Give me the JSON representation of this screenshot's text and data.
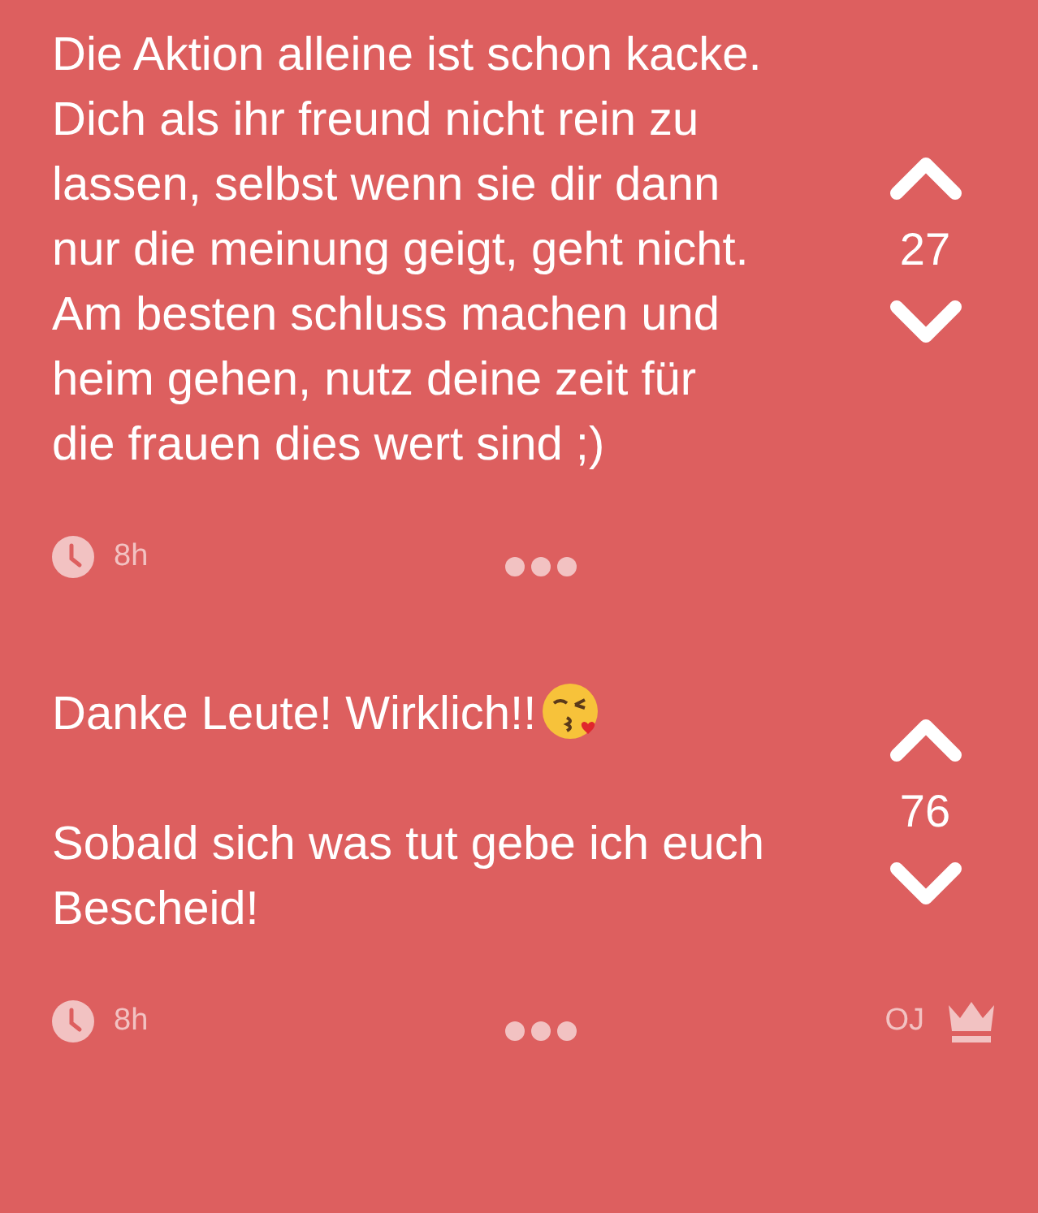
{
  "posts": [
    {
      "paragraphs": [
        {
          "text": "Die Aktion alleine ist schon kacke. Dich als ihr freund nicht rein zu lassen, selbst wenn sie dir dann nur die meinung geigt, geht nicht. Am besten schluss machen und heim gehen, nutz deine zeit für die frauen dies wert sind ;)",
          "emoji": false
        }
      ],
      "votes": "27",
      "time": "8h"
    },
    {
      "paragraphs": [
        {
          "text": "Danke Leute! Wirklich!!",
          "emoji": true
        },
        {
          "text": "Sobald sich was tut gebe ich euch Bescheid!",
          "emoji": false
        }
      ],
      "votes": "76",
      "time": "8h",
      "author_badge": "OJ"
    }
  ]
}
